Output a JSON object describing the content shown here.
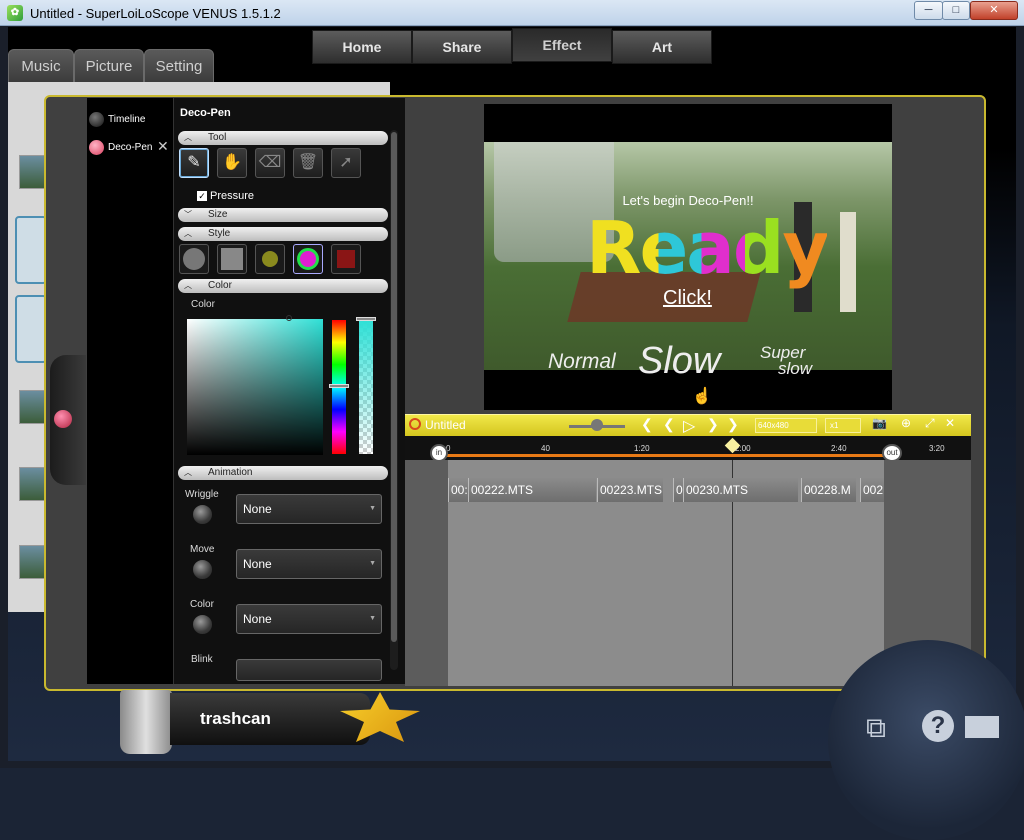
{
  "window": {
    "title": "Untitled - SuperLoiLoScope VENUS 1.5.1.2",
    "icon": "app-icon",
    "minimize": "─",
    "maximize": "□",
    "close": "✕"
  },
  "nav": {
    "items": [
      {
        "label": "Home"
      },
      {
        "label": "Share"
      },
      {
        "label": "Effect",
        "active": true
      },
      {
        "label": "Art"
      }
    ]
  },
  "left_tabs": [
    {
      "label": "Music"
    },
    {
      "label": "Picture"
    },
    {
      "label": "Setting"
    }
  ],
  "sidebar": {
    "items": [
      {
        "label": "Timeline",
        "color": "#333333"
      },
      {
        "label": "Deco-Pen",
        "color": "#e35a74"
      }
    ],
    "close_glyph": "✕"
  },
  "panel": {
    "title": "Deco-Pen",
    "sections": {
      "tool": "Tool",
      "size": "Size",
      "style": "Style",
      "color": "Color",
      "animation": "Animation"
    },
    "pressure_label": "Pressure",
    "pressure_checked": true,
    "color_label": "Color",
    "color_current": "#2fe0d6",
    "animations": [
      {
        "label": "Wriggle",
        "value": "None"
      },
      {
        "label": "Move",
        "value": "None"
      },
      {
        "label": "Color",
        "value": "None"
      },
      {
        "label": "Blink",
        "value": ""
      }
    ]
  },
  "preview": {
    "begin_text": "Let's begin Deco-Pen!!",
    "ready_text": "Ready",
    "click_text": "Click!",
    "normal_text": "Normal",
    "slow_text": "Slow",
    "super_text": "Super",
    "super_slow_text": "slow"
  },
  "timeline": {
    "title": "Untitled",
    "resolution": "640x480",
    "speed": "x1",
    "ticks": [
      "0",
      "40",
      "1:20",
      "2:00",
      "2:40",
      "3:20"
    ],
    "in_label": "in",
    "out_label": "out",
    "clips": [
      "00:",
      "00222.MTS",
      "00223.MTS",
      "0",
      "00:",
      "00230.MTS",
      "00228.M",
      "002"
    ]
  },
  "bottom": {
    "trash_label": "trashcan"
  }
}
